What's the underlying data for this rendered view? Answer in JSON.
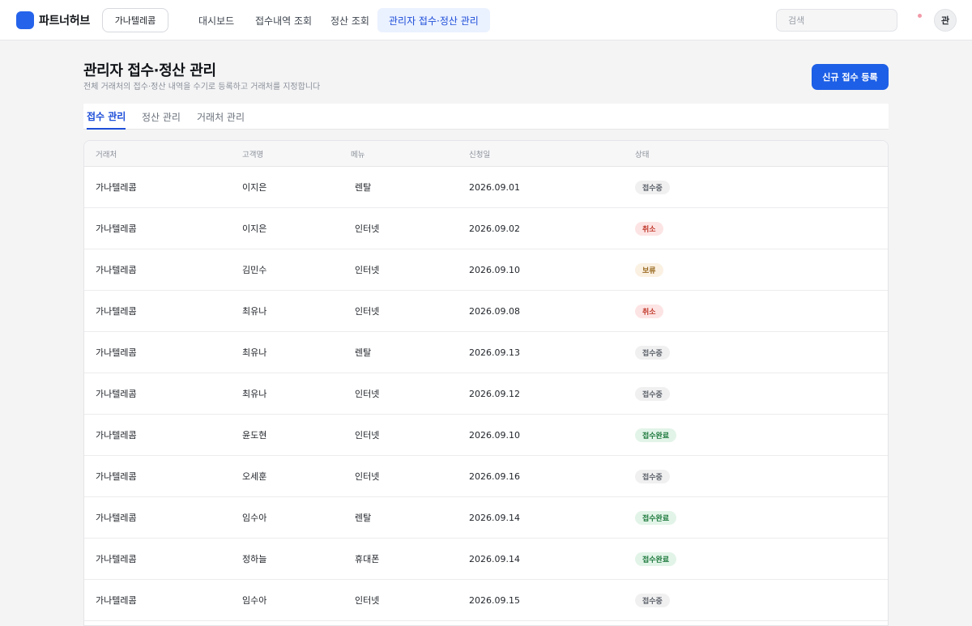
{
  "app": {
    "brand": "파트너허브",
    "partner_selector": "가나텔레콤"
  },
  "nav": {
    "items": [
      {
        "label": "대시보드"
      },
      {
        "label": "접수내역 조회"
      },
      {
        "label": "정산 조회"
      },
      {
        "label": "관리자 접수·정산 관리"
      }
    ],
    "active_index": 3
  },
  "search": {
    "placeholder": "검색"
  },
  "user": {
    "avatar_label": "관"
  },
  "header": {
    "title": "관리자 접수·정산 관리",
    "subtitle": "전체 거래처의 접수·정산 내역을 수기로 등록하고 거래처를 지정합니다",
    "primary_button": "신규 접수 등록"
  },
  "tabs": [
    {
      "label": "접수 관리"
    },
    {
      "label": "정산 관리"
    },
    {
      "label": "거래처 관리"
    }
  ],
  "table": {
    "columns": [
      "거래처",
      "고객명",
      "메뉴",
      "신청일",
      "상태"
    ],
    "rows": [
      {
        "partner": "가나텔레콤",
        "customer": "이지은",
        "menu": "렌탈",
        "date": "2026.09.01",
        "status": "접수중",
        "status_type": "receiving"
      },
      {
        "partner": "가나텔레콤",
        "customer": "이지은",
        "menu": "인터넷",
        "date": "2026.09.02",
        "status": "취소",
        "status_type": "cancel"
      },
      {
        "partner": "가나텔레콤",
        "customer": "김민수",
        "menu": "인터넷",
        "date": "2026.09.10",
        "status": "보류",
        "status_type": "hold"
      },
      {
        "partner": "가나텔레콤",
        "customer": "최유나",
        "menu": "인터넷",
        "date": "2026.09.08",
        "status": "취소",
        "status_type": "cancel"
      },
      {
        "partner": "가나텔레콤",
        "customer": "최유나",
        "menu": "렌탈",
        "date": "2026.09.13",
        "status": "접수중",
        "status_type": "receiving"
      },
      {
        "partner": "가나텔레콤",
        "customer": "최유나",
        "menu": "인터넷",
        "date": "2026.09.12",
        "status": "접수중",
        "status_type": "receiving"
      },
      {
        "partner": "가나텔레콤",
        "customer": "윤도현",
        "menu": "인터넷",
        "date": "2026.09.10",
        "status": "접수완료",
        "status_type": "done"
      },
      {
        "partner": "가나텔레콤",
        "customer": "오세훈",
        "menu": "인터넷",
        "date": "2026.09.16",
        "status": "접수중",
        "status_type": "receiving"
      },
      {
        "partner": "가나텔레콤",
        "customer": "임수아",
        "menu": "렌탈",
        "date": "2026.09.14",
        "status": "접수완료",
        "status_type": "done"
      },
      {
        "partner": "가나텔레콤",
        "customer": "정하늘",
        "menu": "휴대폰",
        "date": "2026.09.14",
        "status": "접수완료",
        "status_type": "done"
      },
      {
        "partner": "가나텔레콤",
        "customer": "임수아",
        "menu": "인터넷",
        "date": "2026.09.15",
        "status": "접수중",
        "status_type": "receiving"
      }
    ]
  },
  "colors": {
    "accent": "#1d5fe6",
    "nav_active_bg": "#eaf1ff",
    "status_receiving": "#f0f0f1",
    "status_cancel": "#fde4e4",
    "status_hold": "#fbf1e3",
    "status_done": "#e2f4e8"
  }
}
